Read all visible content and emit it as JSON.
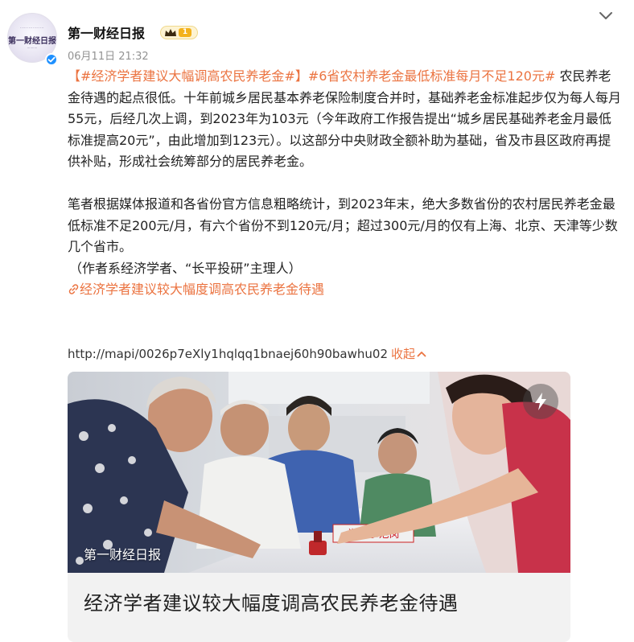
{
  "account": {
    "avatar_text": "第一财经日报",
    "name": "第一财经日报",
    "level": "1",
    "timestamp": "06月11日 21:32"
  },
  "post": {
    "tag1": "【#经济学者建议大幅调高农民养老金#】",
    "tag2": "#6省农村养老金最低标准每月不足120元#",
    "p1_rest": " 农民养老金待遇的起点很低。十年前城乡居民基本养老保险制度合并时，基础养老金标准起步仅为每人每月55元，后经几次上调，到2023年为103元（今年政府工作报告提出“城乡居民基础养老金月最低标准提高20元”，由此增加到123元）。以这部分中央财政全额补助为基础，省及市县区政府再提供补贴，形成社会统筹部分的居民养老金。",
    "p2": "笔者根据媒体报道和各省份官方信息粗略统计，到2023年末，绝大多数省份的农村居民养老金最低标准不足200元/月，有六个省份不到120元/月；超过300元/月的仅有上海、北京、天津等少数几个省市。",
    "p3": "（作者系经济学者、“长平投研”主理人）",
    "link_text": "经济学者建议较大幅度调高农民养老金待遇",
    "url": "http://mapi/0026p7eXly1hqlqq1bnaej60h90bawhu02",
    "collapse_label": "收起"
  },
  "card": {
    "image_source_label": "第一财经日报",
    "sign_text": "党员示范岗",
    "title": "经济学者建议较大幅度调高农民养老金待遇"
  },
  "colors": {
    "accent": "#eb7340",
    "verified": "#1e90ff",
    "text": "#222222",
    "muted": "#939393"
  }
}
